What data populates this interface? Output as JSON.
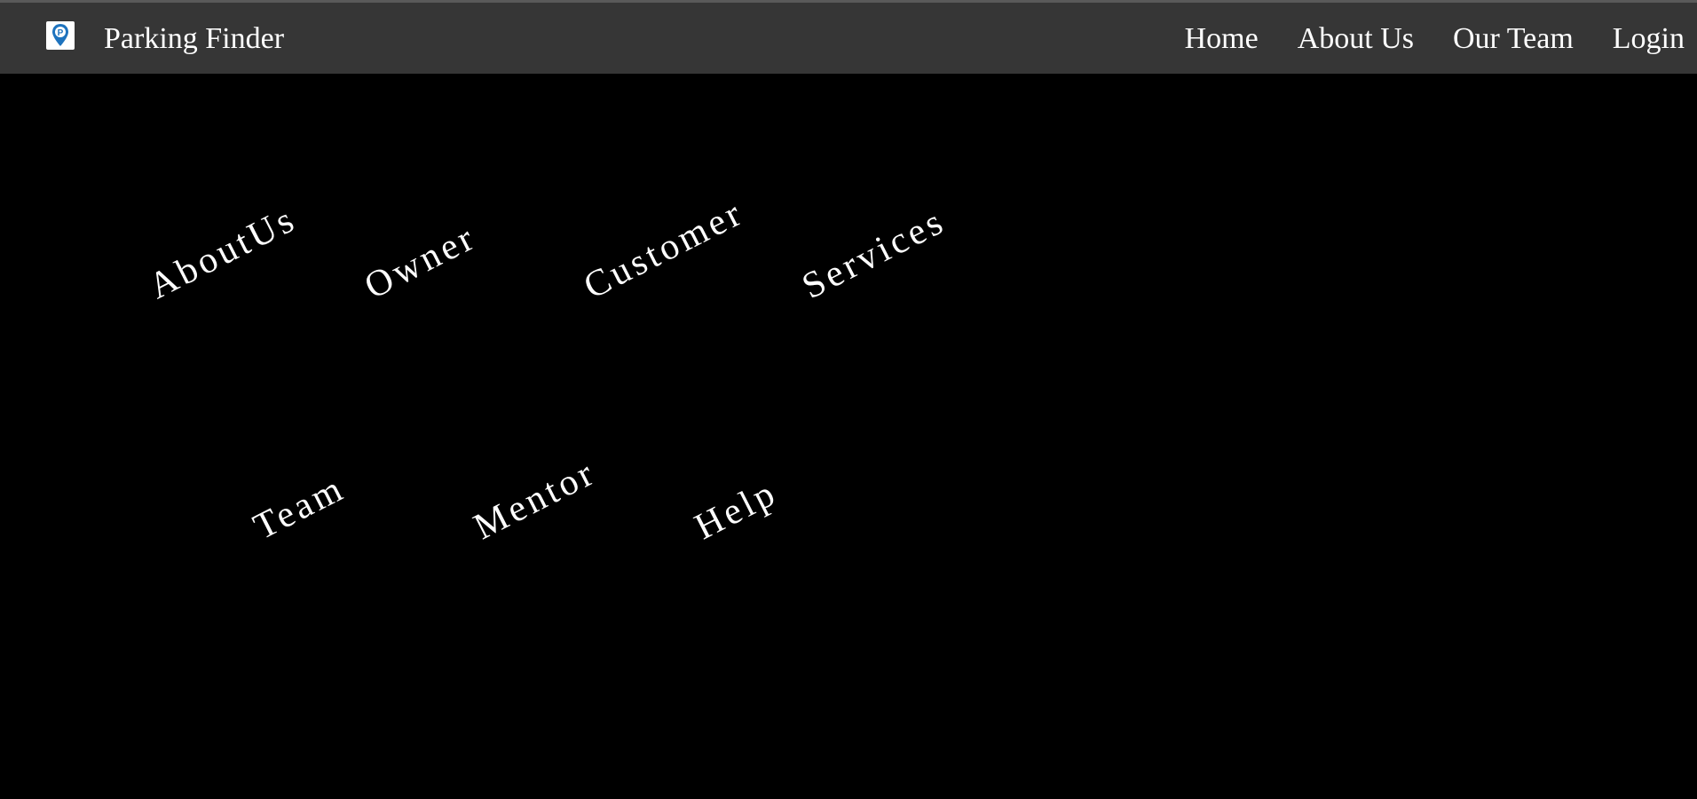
{
  "navbar": {
    "brand": {
      "name": "Parking Finder",
      "logo_icon": "parking-pin-icon"
    },
    "links": [
      {
        "label": "Home"
      },
      {
        "label": "About Us"
      },
      {
        "label": "Our Team"
      },
      {
        "label": "Login"
      }
    ],
    "background": "#363636"
  },
  "stage": {
    "background": "#000000",
    "items": [
      {
        "label": "AboutUs"
      },
      {
        "label": "Owner"
      },
      {
        "label": "Customer"
      },
      {
        "label": "Services"
      },
      {
        "label": "Team"
      },
      {
        "label": "Mentor"
      },
      {
        "label": "Help"
      }
    ],
    "text_color": "#ffffff"
  },
  "colors": {
    "logo_pin": "#1e73be"
  }
}
